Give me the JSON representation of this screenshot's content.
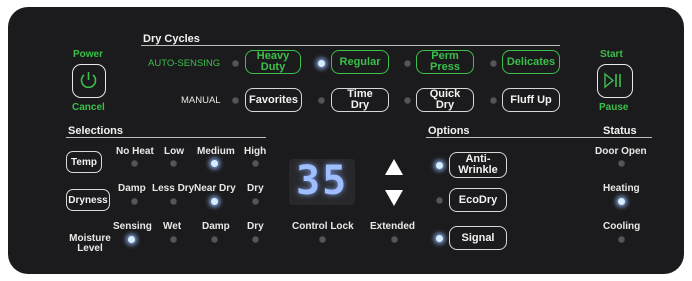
{
  "power": {
    "top": "Power",
    "bottom": "Cancel",
    "icon": "power-icon"
  },
  "start": {
    "top": "Start",
    "bottom": "Pause",
    "icon": "play-pause-icon"
  },
  "dry_cycles": {
    "title": "Dry Cycles",
    "auto_label": "AUTO-SENSING",
    "manual_label": "MANUAL",
    "auto_buttons": [
      "Heavy Duty",
      "Regular",
      "Perm Press",
      "Delicates"
    ],
    "manual_buttons": [
      "Favorites",
      "Time Dry",
      "Quick Dry",
      "Fluff Up"
    ],
    "auto_selected": "Regular"
  },
  "selections": {
    "title": "Selections",
    "temp_button": "Temp",
    "temp_levels": [
      "No Heat",
      "Low",
      "Medium",
      "High"
    ],
    "temp_selected": "Medium",
    "dryness_button": "Dryness",
    "dryness_levels": [
      "Damp",
      "Less Dry",
      "Near Dry",
      "Dry"
    ],
    "dryness_selected": "Near Dry",
    "moisture_label": "Moisture Level",
    "moisture_levels": [
      "Sensing",
      "Wet",
      "Damp",
      "Dry"
    ],
    "moisture_active": "Sensing"
  },
  "display": {
    "value": "35",
    "up_icon": "up-arrow-icon",
    "down_icon": "down-arrow-icon"
  },
  "control_lock": "Control Lock",
  "extended": "Extended",
  "options": {
    "title": "Options",
    "buttons": [
      "Anti-Wrinkle",
      "EcoDry",
      "Signal"
    ],
    "active": [
      "Anti-Wrinkle",
      "Signal"
    ]
  },
  "status": {
    "title": "Status",
    "items": [
      "Door Open",
      "Heating",
      "Cooling"
    ],
    "active": "Heating"
  },
  "colors": {
    "panel": "#1b1b1d",
    "accent_green": "#3bbf4a",
    "led_on": "#d8ecff",
    "digit": "#9fbeff"
  }
}
